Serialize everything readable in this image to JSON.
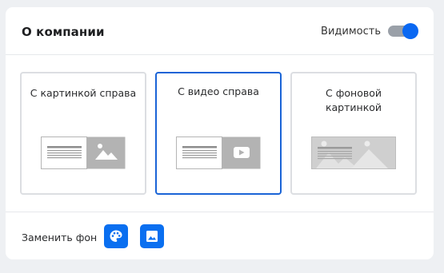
{
  "header": {
    "title": "О компании",
    "visibility_label": "Видимость",
    "visibility_on": true
  },
  "layouts": [
    {
      "label": "С картинкой справа",
      "selected": false,
      "thumb": "image-right"
    },
    {
      "label": "С видео справа",
      "selected": true,
      "thumb": "video-right"
    },
    {
      "label": "С фоновой картинкой",
      "selected": false,
      "thumb": "background-image"
    }
  ],
  "footer": {
    "replace_bg_label": "Заменить фон",
    "buttons": [
      "palette-icon",
      "image-icon"
    ]
  },
  "colors": {
    "accent": "#0a68f2",
    "selected_border": "#1a64d6",
    "card_border": "#dcdee2",
    "thumb_gray": "#b3b3b3"
  }
}
